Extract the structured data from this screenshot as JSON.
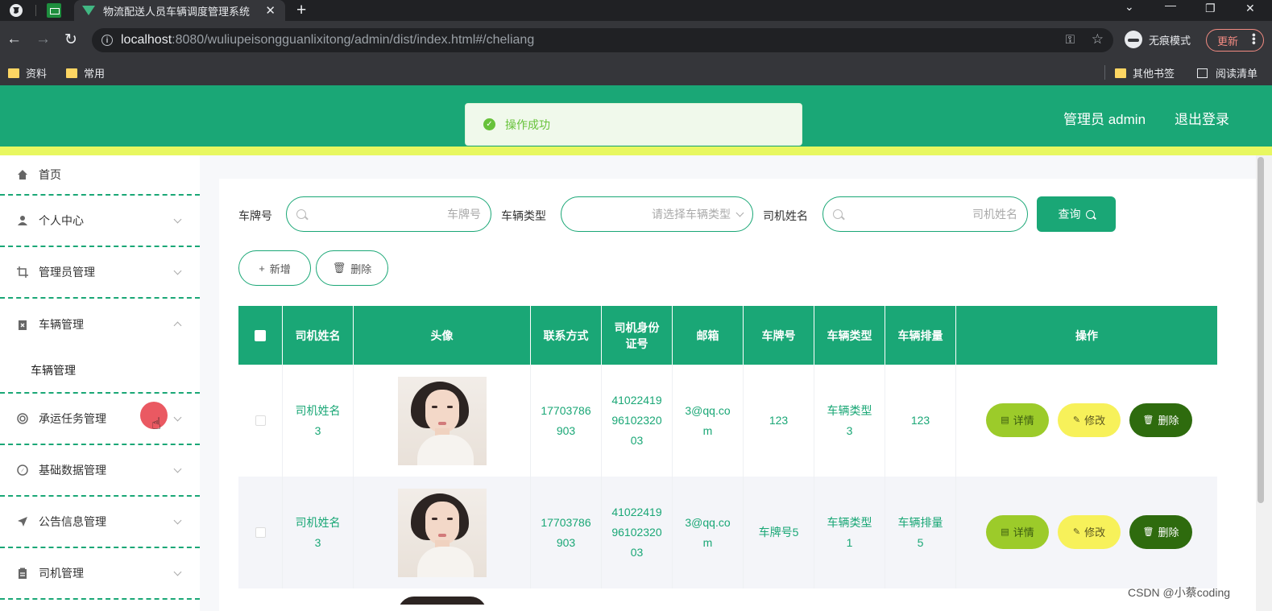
{
  "browser": {
    "tab_title": "物流配送人员车辆调度管理系统",
    "url_host": "localhost",
    "url_rest": ":8080/wuliupeisongguanlixitong/admin/dist/index.html#/cheliang",
    "incognito_label": "无痕模式",
    "update_label": "更新",
    "bookmarks": [
      "资料",
      "常用"
    ],
    "bookmarks_right": [
      "其他书签",
      "阅读清单"
    ]
  },
  "header": {
    "user_label": "管理员 admin",
    "logout_label": "退出登录",
    "accent": "#1aa776",
    "stripe": "#e8f760"
  },
  "toast": {
    "text": "操作成功"
  },
  "sidebar": {
    "home": "首页",
    "items": [
      {
        "label": "个人中心",
        "icon": "user-icon"
      },
      {
        "label": "管理员管理",
        "icon": "crop-icon"
      },
      {
        "label": "车辆管理",
        "icon": "clipboard-x-icon"
      },
      {
        "label": "承运任务管理",
        "icon": "target-icon"
      },
      {
        "label": "基础数据管理",
        "icon": "compass-icon"
      },
      {
        "label": "公告信息管理",
        "icon": "send-icon"
      },
      {
        "label": "司机管理",
        "icon": "clipboard-icon"
      }
    ],
    "submenu": "车辆管理"
  },
  "search": {
    "plate_label": "车牌号",
    "plate_placeholder": "车牌号",
    "type_label": "车辆类型",
    "type_placeholder": "请选择车辆类型",
    "driver_label": "司机姓名",
    "driver_placeholder": "司机姓名",
    "query_label": "查询"
  },
  "actions": {
    "add": "新增",
    "delete": "删除"
  },
  "table": {
    "headers": [
      "司机姓名",
      "头像",
      "联系方式",
      "司机身份证号",
      "邮箱",
      "车牌号",
      "车辆类型",
      "车辆排量",
      "操作"
    ],
    "rows": [
      {
        "driver": "司机姓名3",
        "phone": "17703786903",
        "id_card": "410224199610232003",
        "email": "3@qq.com",
        "plate": "123",
        "type": "车辆类型3",
        "displacement": "123"
      },
      {
        "driver": "司机姓名3",
        "phone": "17703786903",
        "id_card": "410224199610232003",
        "email": "3@qq.com",
        "plate": "车牌号5",
        "type": "车辆类型1",
        "displacement": "车辆排量5"
      }
    ],
    "op_detail": "详情",
    "op_edit": "修改",
    "op_delete": "删除"
  },
  "watermark": "CSDN @小蔡coding"
}
